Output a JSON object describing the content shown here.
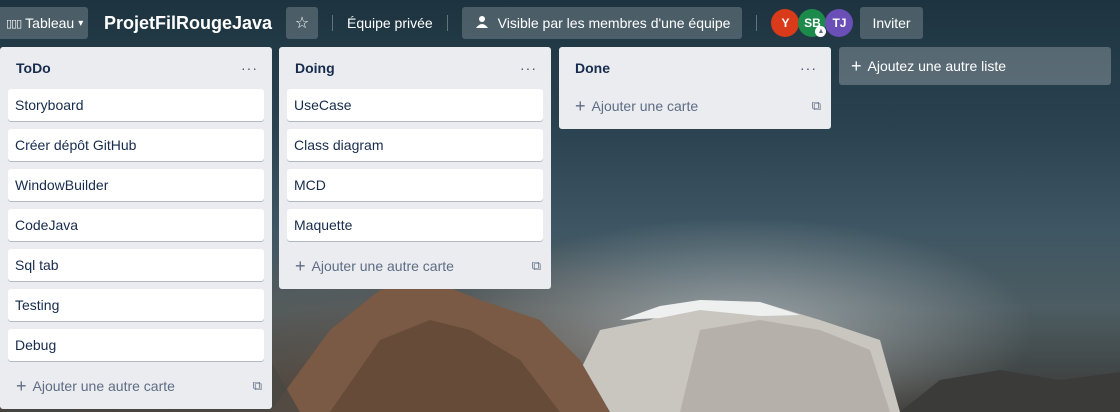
{
  "header": {
    "view_label": "Tableau",
    "board_title": "ProjetFilRougeJava",
    "team_label": "Équipe privée",
    "visibility_label": "Visible par les membres d'une équipe",
    "invite_label": "Inviter",
    "members": [
      {
        "initials": "Y",
        "color": "#d93a1a"
      },
      {
        "initials": "SB",
        "color": "#1c8a4a"
      },
      {
        "initials": "TJ",
        "color": "#6a4fb6"
      }
    ]
  },
  "lists": [
    {
      "title": "ToDo",
      "cards": [
        "Storyboard",
        "Créer dépôt GitHub",
        "WindowBuilder",
        "CodeJava",
        "Sql tab",
        "Testing",
        "Debug"
      ],
      "composer_label": "Ajouter une autre carte"
    },
    {
      "title": "Doing",
      "cards": [
        "UseCase",
        "Class diagram",
        "MCD",
        "Maquette"
      ],
      "composer_label": "Ajouter une autre carte"
    },
    {
      "title": "Done",
      "cards": [],
      "composer_label": "Ajouter une carte"
    }
  ],
  "add_list_label": "Ajoutez une autre liste",
  "icons": {
    "list_menu": "ellipsis-icon",
    "add": "plus-icon",
    "template": "card-template-icon",
    "star": "star-icon",
    "visibility": "team-icon",
    "view": "board-icon",
    "chevron": "chevron-down-icon"
  }
}
